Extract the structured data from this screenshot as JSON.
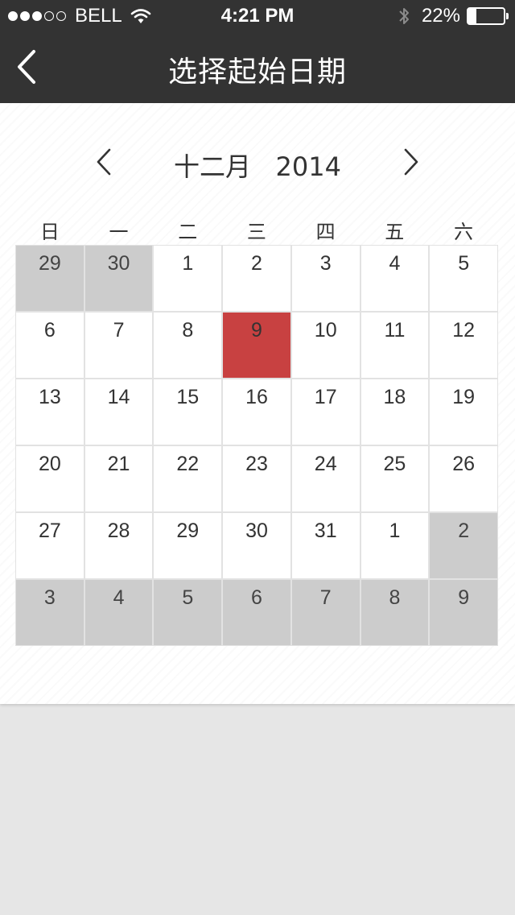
{
  "status_bar": {
    "carrier": "BELL",
    "time": "4:21 PM",
    "battery_text": "22%",
    "battery_level": 0.22,
    "signal_dots_filled": 3,
    "signal_dots_total": 5
  },
  "nav": {
    "title": "选择起始日期",
    "back_icon": "chevron-left-icon"
  },
  "calendar": {
    "month_label": "十二月   2014",
    "prev_icon": "chevron-left-icon",
    "next_icon": "chevron-right-icon",
    "weekdays": [
      "日",
      "一",
      "二",
      "三",
      "四",
      "五",
      "六"
    ],
    "days": [
      {
        "label": "29",
        "state": "other"
      },
      {
        "label": "30",
        "state": "other"
      },
      {
        "label": "1",
        "state": "current"
      },
      {
        "label": "2",
        "state": "current"
      },
      {
        "label": "3",
        "state": "current"
      },
      {
        "label": "4",
        "state": "current"
      },
      {
        "label": "5",
        "state": "current"
      },
      {
        "label": "6",
        "state": "current"
      },
      {
        "label": "7",
        "state": "current"
      },
      {
        "label": "8",
        "state": "current"
      },
      {
        "label": "9",
        "state": "selected"
      },
      {
        "label": "10",
        "state": "current"
      },
      {
        "label": "11",
        "state": "current"
      },
      {
        "label": "12",
        "state": "current"
      },
      {
        "label": "13",
        "state": "current"
      },
      {
        "label": "14",
        "state": "current"
      },
      {
        "label": "15",
        "state": "current"
      },
      {
        "label": "16",
        "state": "current"
      },
      {
        "label": "17",
        "state": "current"
      },
      {
        "label": "18",
        "state": "current"
      },
      {
        "label": "19",
        "state": "current"
      },
      {
        "label": "20",
        "state": "current"
      },
      {
        "label": "21",
        "state": "current"
      },
      {
        "label": "22",
        "state": "current"
      },
      {
        "label": "23",
        "state": "current"
      },
      {
        "label": "24",
        "state": "current"
      },
      {
        "label": "25",
        "state": "current"
      },
      {
        "label": "26",
        "state": "current"
      },
      {
        "label": "27",
        "state": "current"
      },
      {
        "label": "28",
        "state": "current"
      },
      {
        "label": "29",
        "state": "current"
      },
      {
        "label": "30",
        "state": "current"
      },
      {
        "label": "31",
        "state": "current"
      },
      {
        "label": "1",
        "state": "current"
      },
      {
        "label": "2",
        "state": "other"
      },
      {
        "label": "3",
        "state": "other"
      },
      {
        "label": "4",
        "state": "other"
      },
      {
        "label": "5",
        "state": "other"
      },
      {
        "label": "6",
        "state": "other"
      },
      {
        "label": "7",
        "state": "other"
      },
      {
        "label": "8",
        "state": "other"
      },
      {
        "label": "9",
        "state": "other"
      }
    ]
  },
  "colors": {
    "header_bg": "#333333",
    "selected_day": "#c84141",
    "other_month_day": "#cccccc",
    "page_bg": "#e6e6e6"
  }
}
